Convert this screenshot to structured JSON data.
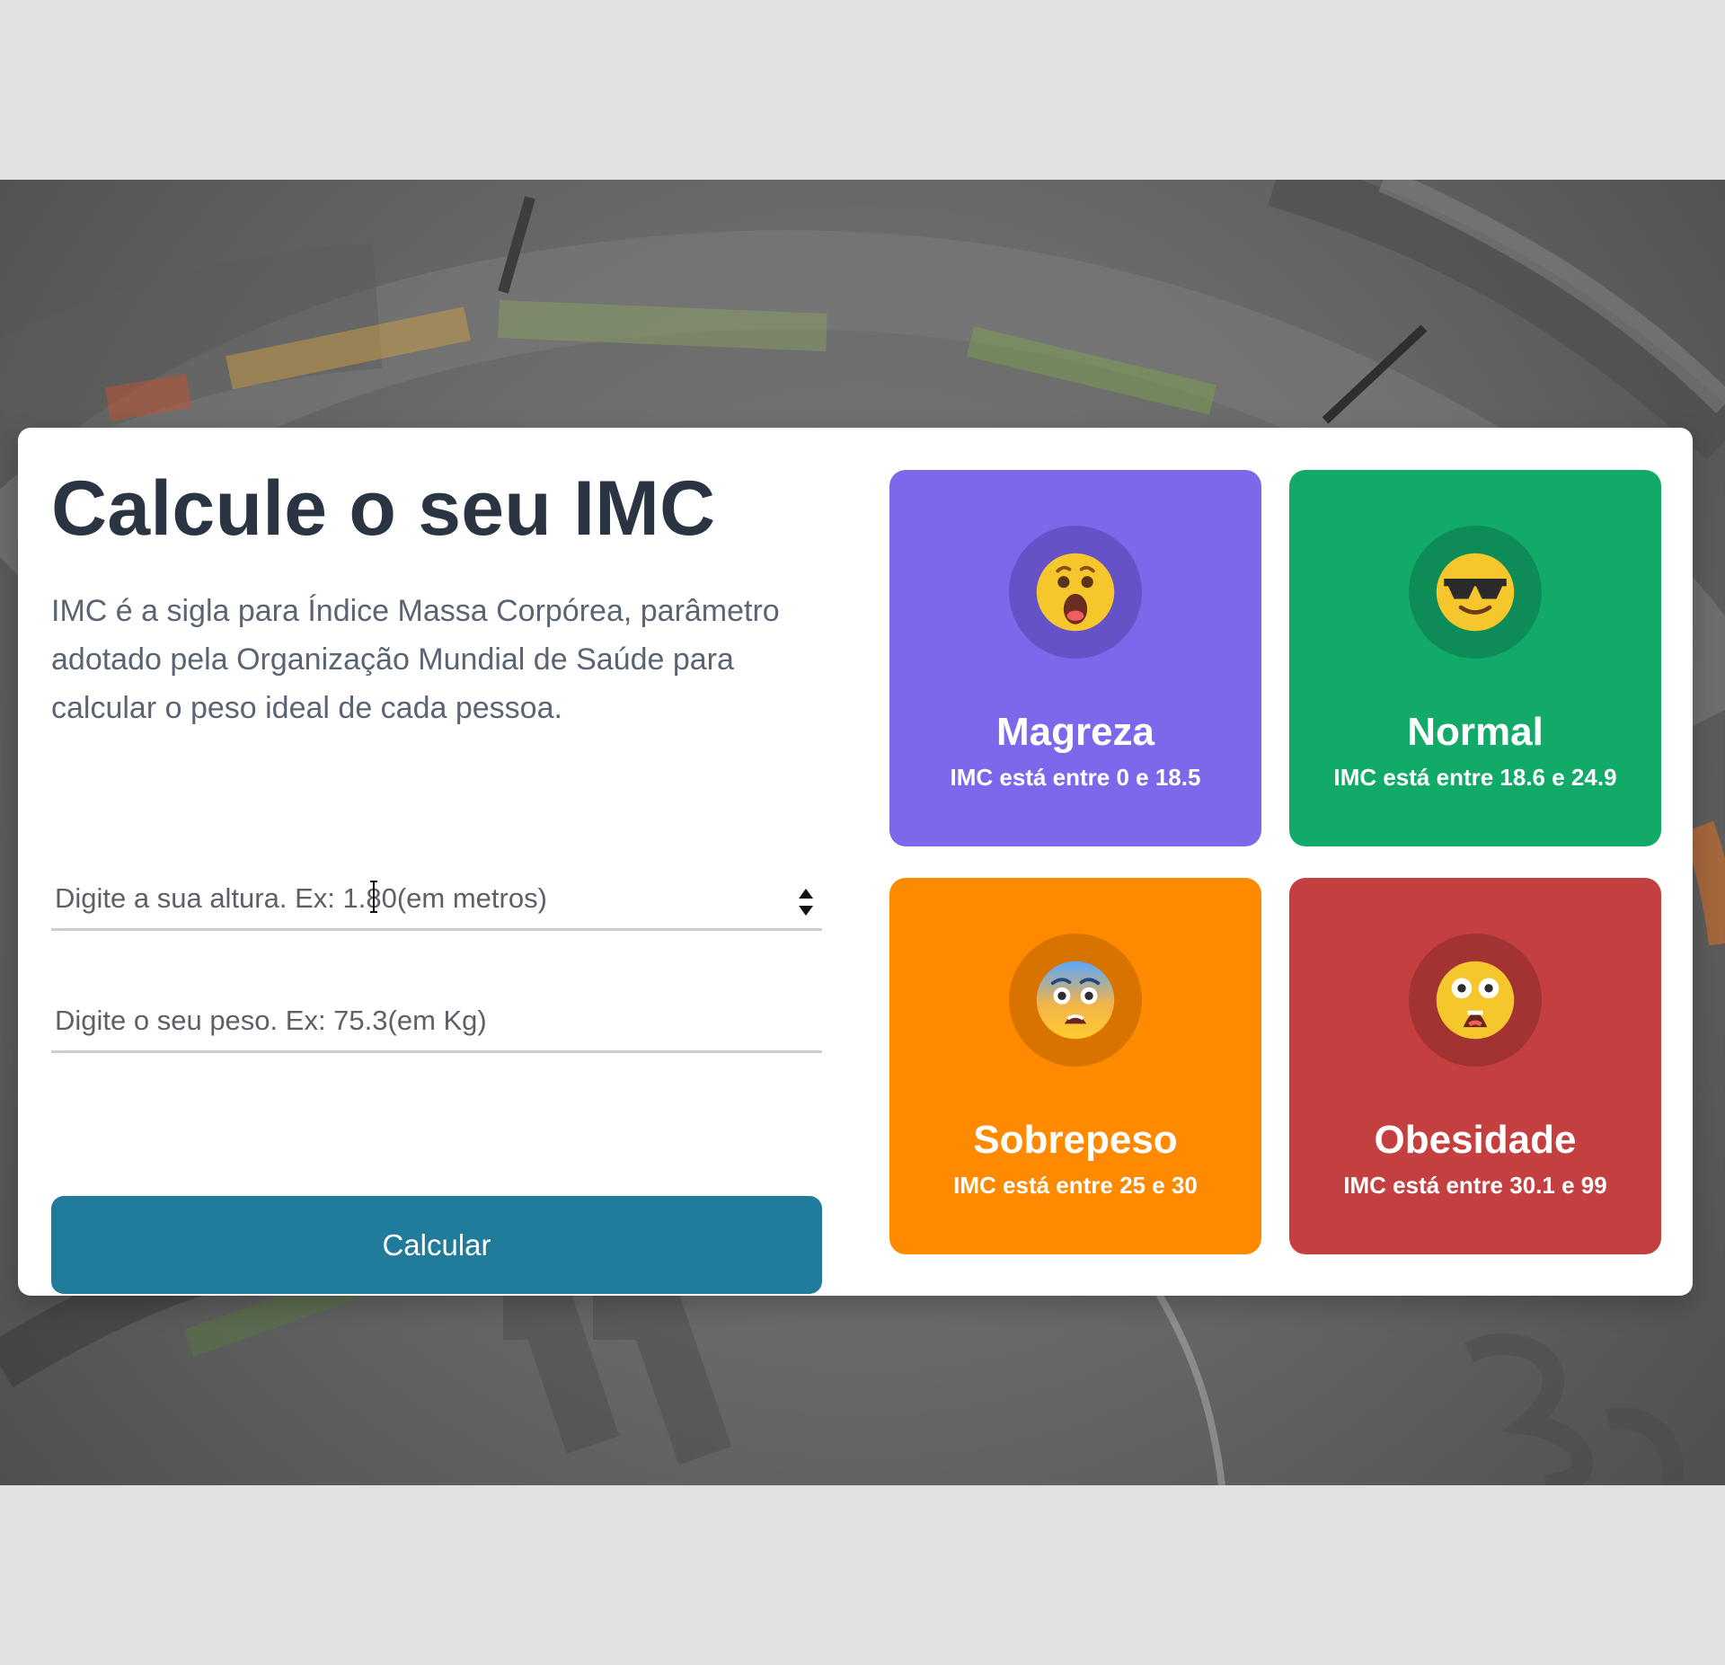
{
  "app": {
    "title": "Calcule o seu IMC",
    "description": "IMC é a sigla para Índice Massa Corpórea, parâmetro adotado pela Organização Mundial de Saúde para calcular o peso ideal de cada pessoa."
  },
  "form": {
    "height_placeholder": "Digite a sua altura. Ex: 1.80(em metros)",
    "weight_placeholder": "Digite o seu peso. Ex: 75.3(em Kg)",
    "height_value": "",
    "weight_value": "",
    "button_label": "Calcular"
  },
  "categories": [
    {
      "title": "Magreza",
      "range": "IMC está entre 0 e 18.5",
      "icon": "shocked-face-icon",
      "color": "#7b68ea"
    },
    {
      "title": "Normal",
      "range": "IMC está entre 18.6 e 24.9",
      "icon": "sunglasses-face-icon",
      "color": "#12aa69"
    },
    {
      "title": "Sobrepeso",
      "range": "IMC está entre 25 e 30",
      "icon": "fearful-face-icon",
      "color": "#ff8a00"
    },
    {
      "title": "Obesidade",
      "range": "IMC está entre 30.1 e 99",
      "icon": "astonished-face-icon",
      "color": "#c43f3f"
    }
  ]
}
